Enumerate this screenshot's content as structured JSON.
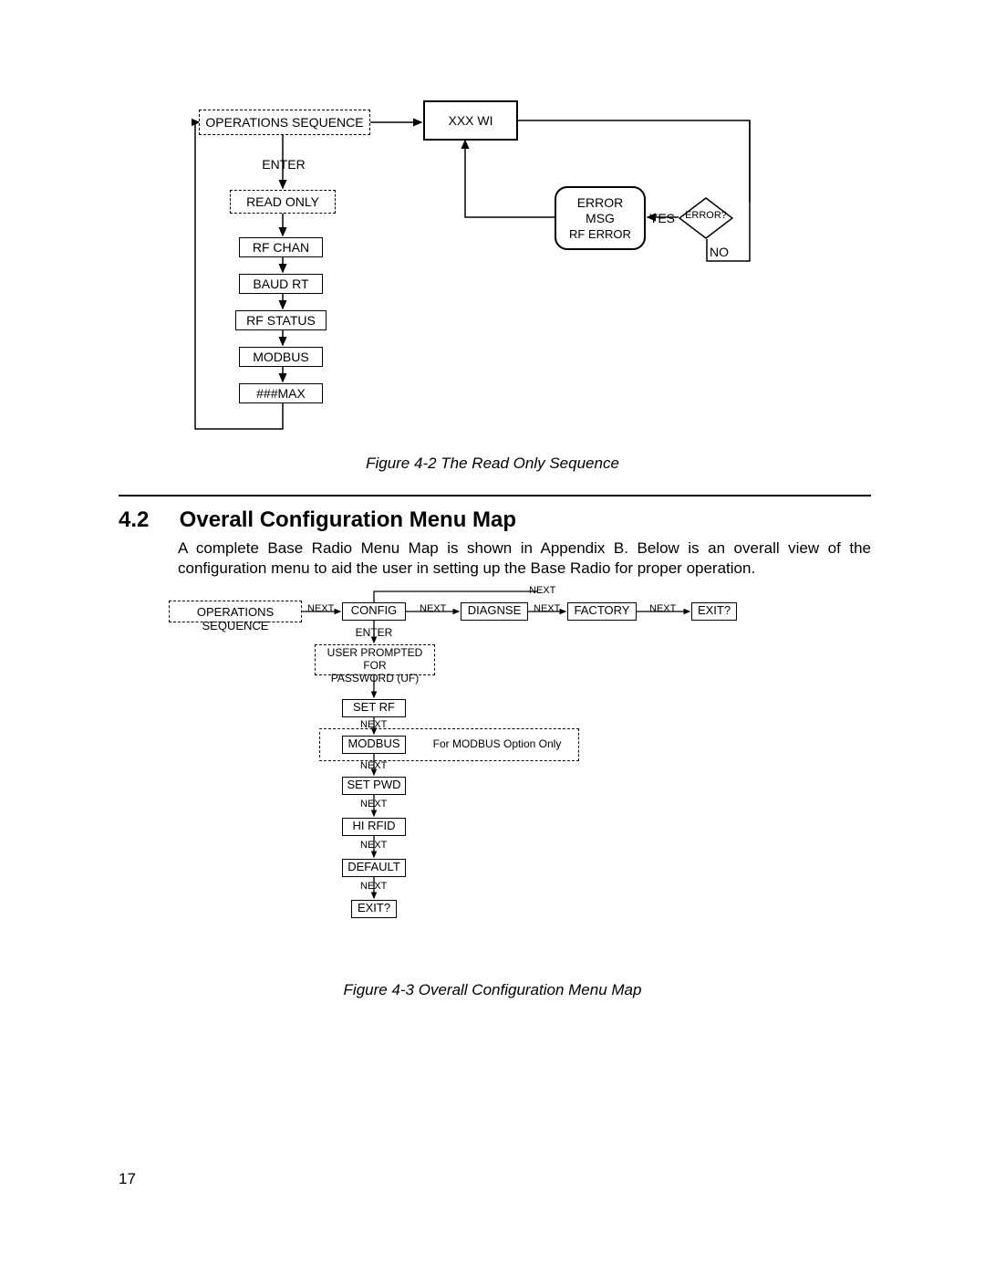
{
  "figure42": {
    "caption": "Figure 4-2 The Read Only Sequence",
    "nodes": {
      "operations_sequence": "OPERATIONS SEQUENCE",
      "xxx_wi": "XXX WI",
      "enter": "ENTER",
      "read_only": "READ ONLY",
      "rf_chan": "RF CHAN",
      "baud_rt": "BAUD RT",
      "rf_status": "RF STATUS",
      "modbus": "MODBUS",
      "max_box": "###MAX",
      "error_msg_line1": "ERROR",
      "error_msg_line2": "MSG",
      "error_msg_line3": "RF ERROR",
      "error_q": "ERROR?",
      "yes": "YES",
      "no": "NO"
    }
  },
  "section": {
    "number": "4.2",
    "title": "Overall Configuration Menu Map",
    "paragraph": "A complete Base Radio Menu Map is shown in Appendix B. Below is an overall view of the configuration menu to aid the user in setting up the Base Radio for proper operation."
  },
  "figure43": {
    "caption": "Figure 4-3 Overall Configuration Menu Map",
    "nodes": {
      "operations_sequence": "OPERATIONS SEQUENCE",
      "config": "CONFIG",
      "diagnse": "DIAGNSE",
      "factory": "FACTORY",
      "exit_top": "EXIT?",
      "enter": "ENTER",
      "password_prompt_line1": "USER PROMPTED FOR",
      "password_prompt_line2": "PASSWORD (UF)",
      "set_rf": "SET RF",
      "modbus": "MODBUS",
      "modbus_note": "For MODBUS Option Only",
      "set_pwd": "SET PWD",
      "hi_rfid": "HI RFID",
      "default": "DEFAULT",
      "exit_bottom": "EXIT?",
      "next": "NEXT"
    }
  },
  "page_number": "17"
}
